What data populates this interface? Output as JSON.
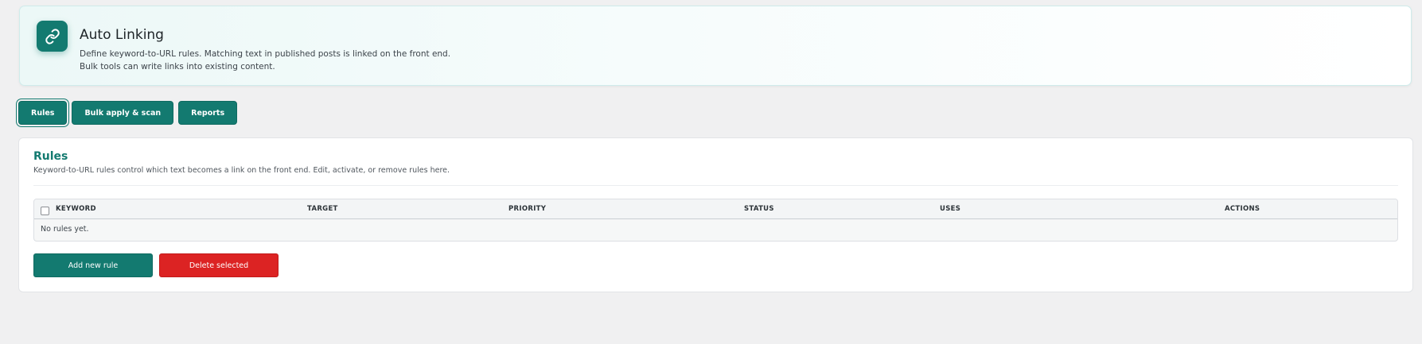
{
  "header": {
    "title": "Auto Linking",
    "description_line1": "Define keyword-to-URL rules. Matching text in published posts is linked on the front end.",
    "description_line2": "Bulk tools can write links into existing content.",
    "icon": "link-icon"
  },
  "tabs": [
    {
      "label": "Rules",
      "active": true
    },
    {
      "label": "Bulk apply & scan",
      "active": false
    },
    {
      "label": "Reports",
      "active": false
    }
  ],
  "rules_panel": {
    "title": "Rules",
    "description": "Keyword-to-URL rules control which text becomes a link on the front end. Edit, activate, or remove rules here.",
    "columns": [
      "KEYWORD",
      "TARGET",
      "PRIORITY",
      "STATUS",
      "USES",
      "ACTIONS"
    ],
    "empty_message": "No rules yet.",
    "add_label": "Add new rule",
    "delete_label": "Delete selected"
  },
  "colors": {
    "accent": "#137a70",
    "danger": "#dc2323",
    "background": "#f0f0f1"
  }
}
